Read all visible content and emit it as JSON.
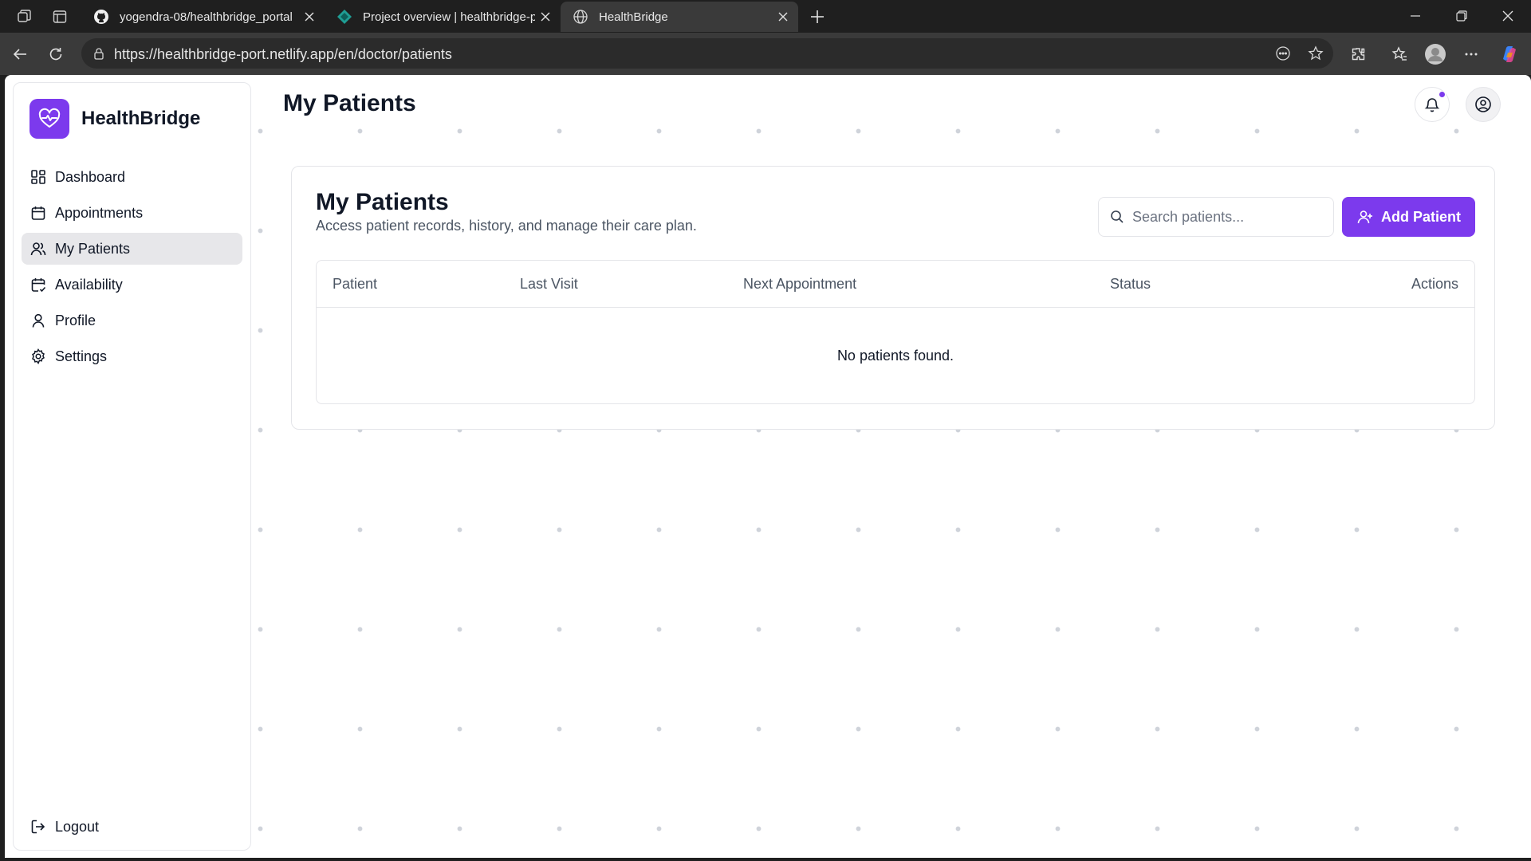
{
  "browser": {
    "tabs": [
      {
        "title": "yogendra-08/healthbridge_portal",
        "icon": "github-icon"
      },
      {
        "title": "Project overview | healthbridge-port",
        "icon": "netlify-icon"
      },
      {
        "title": "HealthBridge",
        "icon": "globe-icon",
        "active": true
      }
    ],
    "url": "https://healthbridge-port.netlify.app/en/doctor/patients"
  },
  "sidebar": {
    "brand": "HealthBridge",
    "items": [
      {
        "label": "Dashboard",
        "icon": "dashboard-icon"
      },
      {
        "label": "Appointments",
        "icon": "calendar-icon"
      },
      {
        "label": "My Patients",
        "icon": "users-icon",
        "active": true
      },
      {
        "label": "Availability",
        "icon": "calendar-check-icon"
      },
      {
        "label": "Profile",
        "icon": "user-icon"
      },
      {
        "label": "Settings",
        "icon": "gear-icon"
      }
    ],
    "logout": "Logout"
  },
  "header": {
    "title": "My Patients",
    "notification_badge": true
  },
  "main": {
    "title": "My Patients",
    "subtitle": "Access patient records, history, and manage their care plan.",
    "search_placeholder": "Search patients...",
    "add_button": "Add Patient",
    "table": {
      "columns": [
        "Patient",
        "Last Visit",
        "Next Appointment",
        "Status",
        "Actions"
      ],
      "rows": [],
      "empty_message": "No patients found."
    }
  },
  "colors": {
    "accent": "#7c3aed",
    "active_nav_bg": "#e7e7ea",
    "text_primary": "#111827",
    "text_muted": "#4b5563"
  }
}
